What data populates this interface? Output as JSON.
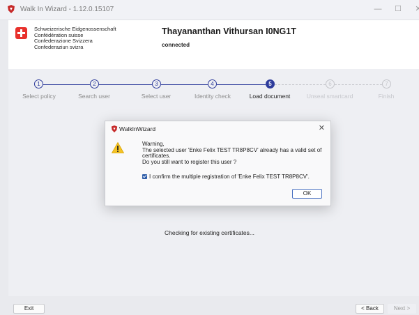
{
  "window": {
    "title": "Walk In Wizard - 1.12.0.15107",
    "minimize_glyph": "—",
    "maximize_glyph": "☐",
    "close_glyph": "✕"
  },
  "header": {
    "confederation": [
      "Schweizerische Eidgenossenschaft",
      "Confédération suisse",
      "Confederazione Svizzera",
      "Confederaziun svizra"
    ],
    "user_name": "Thayananthan Vithursan I0NG1T",
    "connection_status": "connected"
  },
  "steps": [
    {
      "number": "1",
      "label": "Select policy",
      "state": "done"
    },
    {
      "number": "2",
      "label": "Search user",
      "state": "done"
    },
    {
      "number": "3",
      "label": "Select user",
      "state": "done"
    },
    {
      "number": "4",
      "label": "Identity check",
      "state": "done"
    },
    {
      "number": "5",
      "label": "Load document",
      "state": "current"
    },
    {
      "number": "6",
      "label": "Unseal smartcard",
      "state": "todo"
    },
    {
      "number": "7",
      "label": "Finish",
      "state": "todo"
    }
  ],
  "main": {
    "status_text": "Checking for existing certificates..."
  },
  "dialog": {
    "title": "WalkInWizard",
    "close_glyph": "✕",
    "message_lines": [
      "Warning,",
      "The selected user 'Enke Felix TEST TR8P8CV' already has a valid set of",
      "certificates.",
      "Do you still want to register this user ?"
    ],
    "checkbox_label": "I confirm the multiple registration of 'Enke Felix TEST TR8P8CV'.",
    "checkbox_checked": true,
    "ok_label": "OK"
  },
  "footer": {
    "exit_label": "Exit",
    "back_label": "< Back",
    "next_label": "Next >"
  },
  "colors": {
    "accent": "#2d3b9b",
    "swiss_red": "#e8312c",
    "warning_yellow": "#f5c325"
  }
}
